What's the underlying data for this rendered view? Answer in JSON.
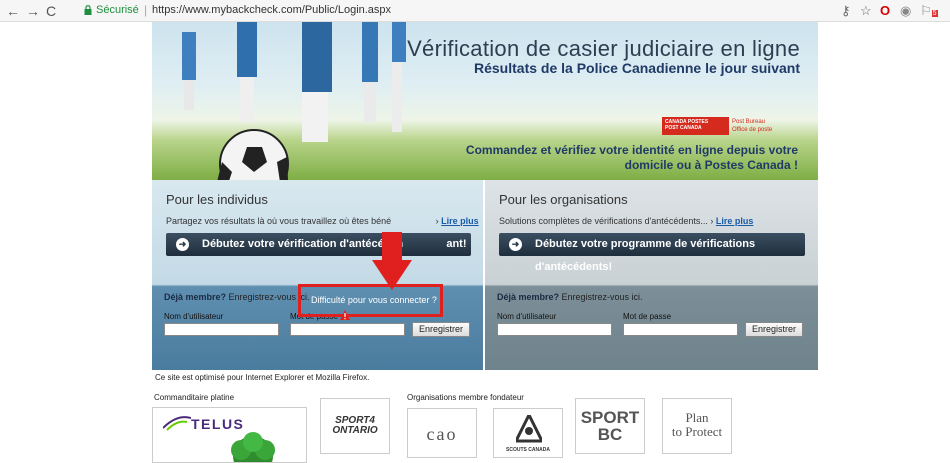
{
  "browser": {
    "secure_label": "Sécurisé",
    "url": "https://www.mybackcheck.com/Public/Login.aspx",
    "extension_badge": "5"
  },
  "hero": {
    "title": "Vérification de casier judiciaire en ligne",
    "subtitle": "Résultats de la Police Canadienne le jour suivant",
    "cta_line1": "Commandez et vérifiez votre identité en ligne depuis votre",
    "cta_line2": "domicile ou à Postes Canada !",
    "canada_post": {
      "red_line1": "CANADA  POSTES",
      "red_line2": "POST  CANADA",
      "text_line1": "Post  Bureau",
      "text_line2": "Office  de poste"
    }
  },
  "individuals": {
    "title": "Pour les individus",
    "desc": "Partagez vos résultats là où vous travaillez où êtes béné",
    "more_link": "Lire plus",
    "start_button": "Débutez votre vérification d'antécéden",
    "start_button_tail": "ant!",
    "member_bold": "Déjà membre?",
    "member_text": " Enregistrez-vous ici.",
    "help_link": "Difficulté pour vous connecter ?",
    "username_label": "Nom d'utilisateur",
    "password_label": "Mot de passe",
    "submit": "Enregistrer"
  },
  "organizations": {
    "title": "Pour les organisations",
    "desc": "Solutions complètes de vérifications d'antécédents...",
    "more_link": "Lire plus",
    "start_button": "Débutez votre programme de vérifications d'antécédents!",
    "member_bold": "Déjà membre?",
    "member_text": " Enregistrez-vous ici.",
    "username_label": "Nom d'utilisateur",
    "password_label": "Mot de passe",
    "submit": "Enregistrer"
  },
  "footer": {
    "optimized": "Ce site est optimisé pour Internet Explorer et Mozilla Firefox.",
    "sponsor_label": "Commanditaire platine",
    "telus": "TELUS",
    "founders_label": "Organisations membre fondateur",
    "sport4": "SPORT4\nONTARIO",
    "cao": "cao",
    "scouts": "SCOUTS CANADA",
    "sportbc": "SPORT\nBC",
    "plan": "Plan\nto Protect"
  },
  "colors": {
    "highlight": "#e0201f",
    "link": "#1a5aa8",
    "button": "#2a3b4b"
  }
}
